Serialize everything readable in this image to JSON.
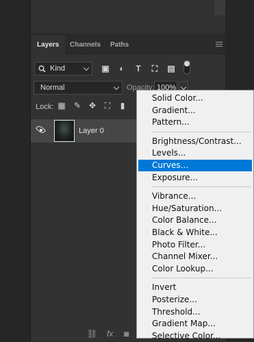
{
  "panel": {
    "tabs": [
      {
        "label": "Layers"
      },
      {
        "label": "Channels"
      },
      {
        "label": "Paths"
      }
    ],
    "filter_kind": "Kind",
    "blend_mode": "Normal",
    "opacity_label": "Opacity:",
    "opacity_value": "100%",
    "lock_label": "Lock:"
  },
  "layers": [
    {
      "name": "Layer 0",
      "visible": true
    }
  ],
  "menu": {
    "groups": [
      [
        "Solid Color...",
        "Gradient...",
        "Pattern..."
      ],
      [
        "Brightness/Contrast...",
        "Levels...",
        "Curves...",
        "Exposure..."
      ],
      [
        "Vibrance...",
        "Hue/Saturation...",
        "Color Balance...",
        "Black & White...",
        "Photo Filter...",
        "Channel Mixer...",
        "Color Lookup..."
      ],
      [
        "Invert",
        "Posterize...",
        "Threshold...",
        "Gradient Map...",
        "Selective Color..."
      ]
    ],
    "highlighted": "Curves...",
    "highlight_color": "#0078d7"
  },
  "bottom_icons": [
    "link-icon",
    "fx-icon",
    "mask-icon"
  ],
  "bottom_fx": "fx"
}
